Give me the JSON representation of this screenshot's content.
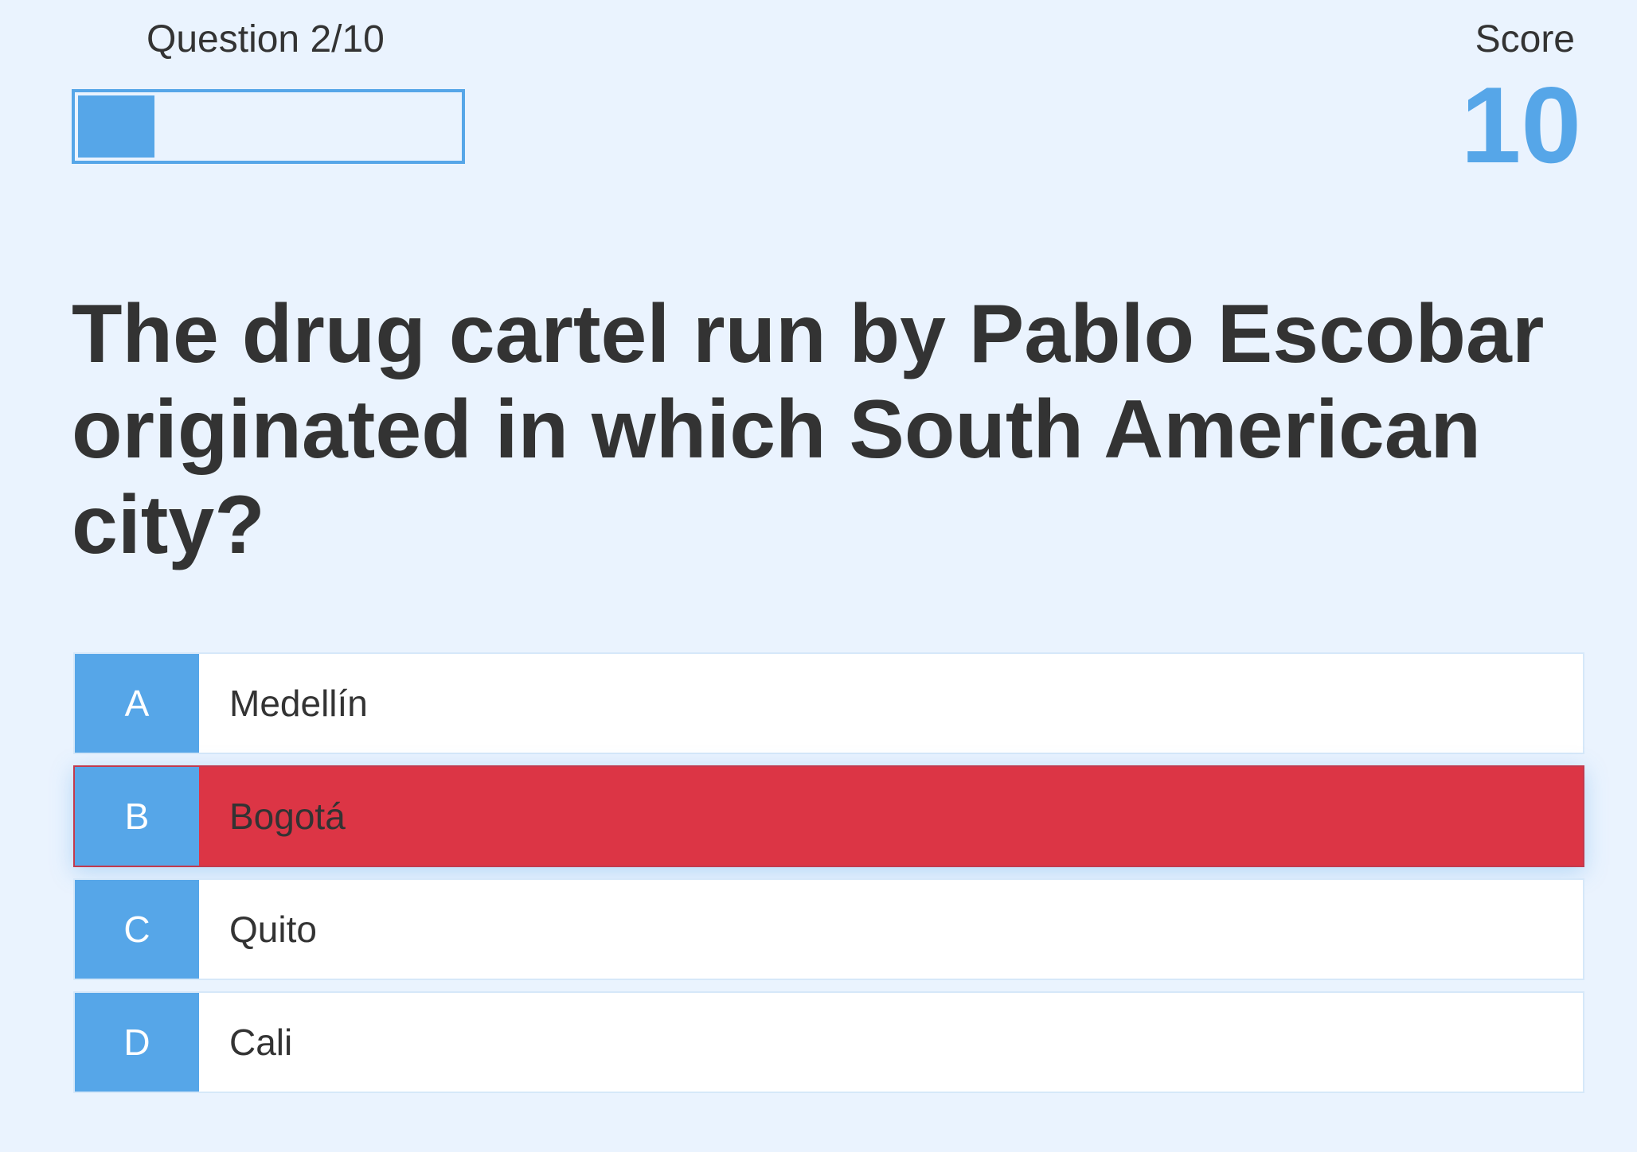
{
  "header": {
    "question_counter": "Question 2/10",
    "progress": 0.2,
    "score_label": "Score",
    "score_value": "10"
  },
  "question": {
    "text": "The drug cartel run by Pablo Escobar originated in which South American city?"
  },
  "options": [
    {
      "letter": "A",
      "text": "Medellín",
      "state": "default"
    },
    {
      "letter": "B",
      "text": "Bogotá",
      "state": "selected-wrong"
    },
    {
      "letter": "C",
      "text": "Quito",
      "state": "default"
    },
    {
      "letter": "D",
      "text": "Cali",
      "state": "default"
    }
  ],
  "colors": {
    "background": "#eaf3fe",
    "accent": "#56a6e8",
    "wrong": "#dc3545",
    "text": "#333333"
  }
}
